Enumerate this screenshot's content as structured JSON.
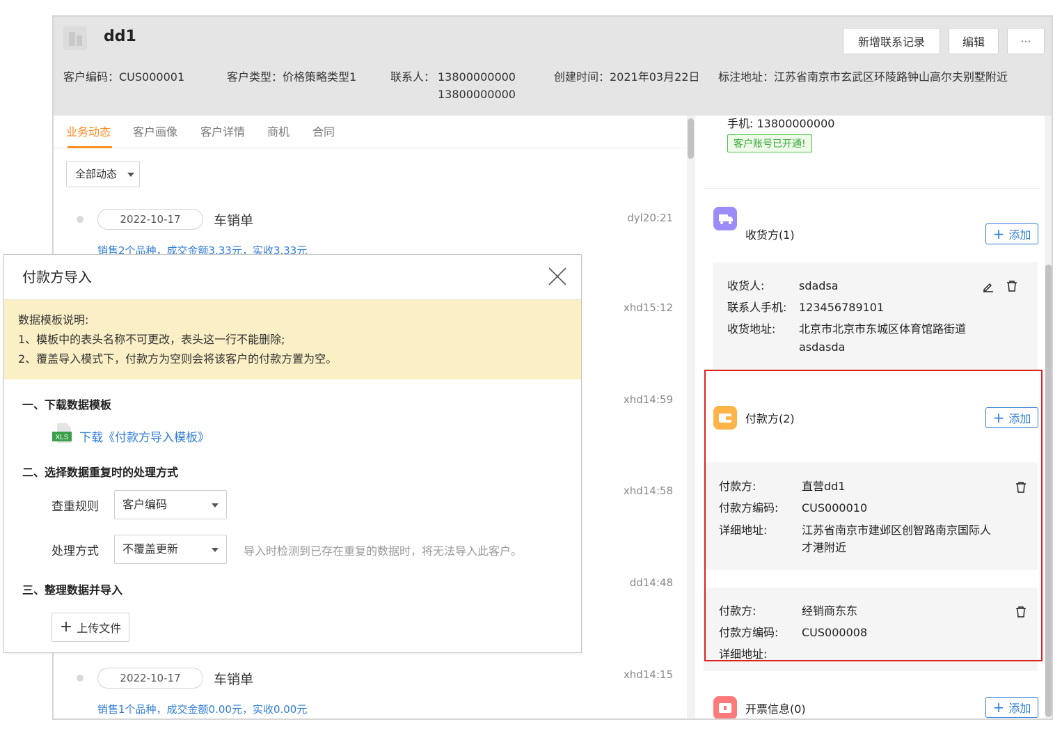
{
  "customer": {
    "name": "dd1",
    "buttons": {
      "new_contact": "新增联系记录",
      "edit": "编辑",
      "more": "···"
    },
    "meta": {
      "code": "客户编码：CUS000001",
      "type": "客户类型：价格策略类型1",
      "contact_label": "联系人：",
      "contact_1": "13800000000",
      "contact_2": "13800000000",
      "created": "创建时间：2021年03月22日",
      "address": "标注地址：江苏省南京市玄武区环陵路钟山高尔夫别墅附近"
    }
  },
  "tabs": [
    "业务动态",
    "客户画像",
    "客户详情",
    "商机",
    "合同"
  ],
  "filter": {
    "value": "全部动态"
  },
  "timeline": [
    {
      "date": "2022-10-17",
      "type": "车销单",
      "who": "dyl20:21",
      "summary": "销售2个品种，成交金额3.33元，实收3.33元"
    },
    {
      "who": "xhd15:12"
    },
    {
      "who": "xhd14:59"
    },
    {
      "who": "xhd14:58"
    },
    {
      "who": "dd14:48"
    },
    {
      "date": "2022-10-17",
      "type": "车销单",
      "who": "xhd14:15",
      "summary": "销售1个品种，成交金额0.00元，实收0.00元"
    }
  ],
  "right": {
    "phone": "手机: 13800000000",
    "account_badge": "客户账号已开通!",
    "add_label": "添加",
    "receiver": {
      "title": "收货方(1)",
      "items": [
        {
          "k1": "收货人:",
          "v1": "sdadsa",
          "k2": "联系人手机:",
          "v2": "123456789101",
          "k3": "收货地址:",
          "v3a": "北京市北京市东城区体育馆路街道",
          "v3b": "asdasda"
        }
      ]
    },
    "payer": {
      "title": "付款方(2)",
      "items": [
        {
          "k1": "付款方:",
          "v1": "直营dd1",
          "k2": "付款方编码:",
          "v2": "CUS000010",
          "k3": "详细地址:",
          "v3a": "江苏省南京市建邺区创智路南京国际人",
          "v3b": "才港附近"
        },
        {
          "k1": "付款方:",
          "v1": "经销商东东",
          "k2": "付款方编码:",
          "v2": "CUS000008",
          "k3": "详细地址:",
          "v3a": "",
          "v3b": ""
        }
      ]
    },
    "invoice": {
      "title": "开票信息(0)"
    },
    "colors": {
      "receiver_icon": "#9b8cf7",
      "payer_icon": "#ffb44a",
      "invoice_icon": "#ff7a7a",
      "highlight": "#e02020"
    }
  },
  "modal": {
    "title": "付款方导入",
    "notes": [
      "数据模板说明:",
      "1、模板中的表头名称不可更改，表头这一行不能删除;",
      "2、覆盖导入模式下，付款方为空则会将该客户的付款方置为空。"
    ],
    "step1": "一、下载数据模板",
    "download_icon_text": "XLS",
    "download_link": "下载《付款方导入模板》",
    "step2": "二、选择数据重复时的处理方式",
    "rule_label": "查重规则",
    "rule_value": "客户编码",
    "mode_label": "处理方式",
    "mode_value": "不覆盖更新",
    "mode_hint": "导入时检测到已存在重复的数据时，将无法导入此客户。",
    "step3": "三、整理数据并导入",
    "upload": "上传文件"
  }
}
